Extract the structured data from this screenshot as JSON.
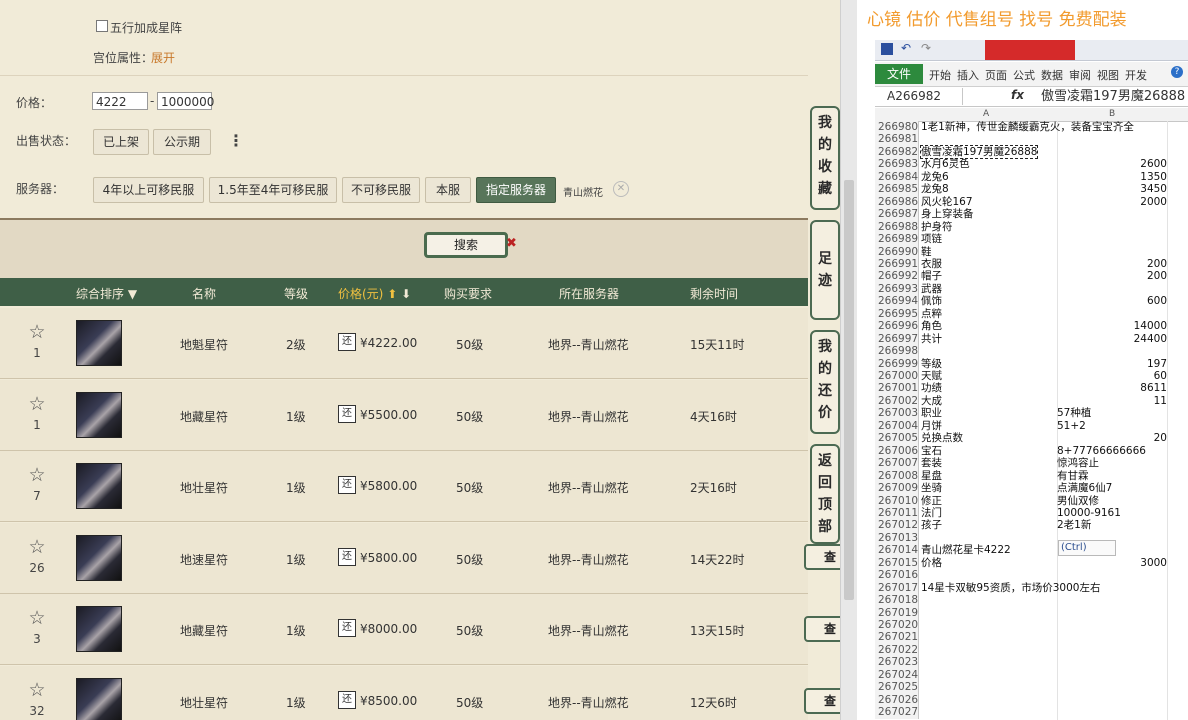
{
  "filters": {
    "wuxing_label": "五行加成星阵",
    "gongwei_label": "宫位属性：",
    "gongwei_link": "展开",
    "price_label": "价格：",
    "price_min": "4222",
    "price_sep": "-",
    "price_max": "1000000",
    "sale_status_label": "出售状态：",
    "sale_status_options": [
      "已上架",
      "公示期"
    ],
    "more_icon": "⋮",
    "server_label": "服务器：",
    "server_options": [
      "4年以上可移民服",
      "1.5年至4年可移民服",
      "不可移民服",
      "本服",
      "指定服务器"
    ],
    "selected_server": "青山燃花"
  },
  "search": {
    "label": "搜索"
  },
  "table": {
    "headers": {
      "sort": "综合排序",
      "name": "名称",
      "level": "等级",
      "price": "价格(元)",
      "requirement": "购买要求",
      "server": "所在服务器",
      "time_left": "剩余时间"
    },
    "rows": [
      {
        "count": "1",
        "name": "地魁星符",
        "level": "2级",
        "price": "¥4222.00",
        "req": "50级",
        "server": "地界--青山燃花",
        "time": "15天11时"
      },
      {
        "count": "1",
        "name": "地藏星符",
        "level": "1级",
        "price": "¥5500.00",
        "req": "50级",
        "server": "地界--青山燃花",
        "time": "4天16时"
      },
      {
        "count": "7",
        "name": "地壮星符",
        "level": "1级",
        "price": "¥5800.00",
        "req": "50级",
        "server": "地界--青山燃花",
        "time": "2天16时"
      },
      {
        "count": "26",
        "name": "地速星符",
        "level": "1级",
        "price": "¥5800.00",
        "req": "50级",
        "server": "地界--青山燃花",
        "time": "14天22时"
      },
      {
        "count": "3",
        "name": "地藏星符",
        "level": "1级",
        "price": "¥8000.00",
        "req": "50级",
        "server": "地界--青山燃花",
        "time": "13天15时"
      },
      {
        "count": "32",
        "name": "地壮星符",
        "level": "1级",
        "price": "¥8500.00",
        "req": "50级",
        "server": "地界--青山燃花",
        "time": "12天6时"
      }
    ],
    "huan_label": "还",
    "view_label": "查看"
  },
  "side_tabs": [
    {
      "label": "我的收藏"
    },
    {
      "label": "足迹"
    },
    {
      "label": "我的还价"
    },
    {
      "label": "返回顶部"
    }
  ],
  "excel": {
    "banner": "心镜 估价 代售组号 找号 免费配装",
    "file_tab": "文件",
    "ribbon_tabs": [
      "开始",
      "插入",
      "页面",
      "公式",
      "数据",
      "审阅",
      "视图",
      "开发"
    ],
    "name_box": "A266982",
    "fx": "fx",
    "formula": "傲雪凌霜197男魔26888",
    "col_a": "A",
    "col_b": "B",
    "ctrl_tag": "(Ctrl)",
    "rows": [
      {
        "rn": "266980",
        "a": "1老1新神，传世金麟缓霸克火，装备宝宝齐全",
        "b": ""
      },
      {
        "rn": "266981",
        "a": "",
        "b": ""
      },
      {
        "rn": "266982",
        "a": "傲雪凌霜197男魔26888",
        "b": ""
      },
      {
        "rn": "266983",
        "a": "水月6灵色",
        "b": "2600"
      },
      {
        "rn": "266984",
        "a": "龙兔6",
        "b": "1350"
      },
      {
        "rn": "266985",
        "a": "龙兔8",
        "b": "3450"
      },
      {
        "rn": "266986",
        "a": "风火轮167",
        "b": "2000"
      },
      {
        "rn": "266987",
        "a": "身上穿装备",
        "b": ""
      },
      {
        "rn": "266988",
        "a": "护身符",
        "b": ""
      },
      {
        "rn": "266989",
        "a": "项链",
        "b": ""
      },
      {
        "rn": "266990",
        "a": "鞋",
        "b": ""
      },
      {
        "rn": "266991",
        "a": "衣服",
        "b": "200"
      },
      {
        "rn": "266992",
        "a": "帽子",
        "b": "200"
      },
      {
        "rn": "266993",
        "a": "武器",
        "b": ""
      },
      {
        "rn": "266994",
        "a": "佩饰",
        "b": "600"
      },
      {
        "rn": "266995",
        "a": "点粹",
        "b": ""
      },
      {
        "rn": "266996",
        "a": "角色",
        "b": "14000"
      },
      {
        "rn": "266997",
        "a": "共计",
        "b": "24400"
      },
      {
        "rn": "266998",
        "a": "",
        "b": ""
      },
      {
        "rn": "266999",
        "a": "等级",
        "b": "197"
      },
      {
        "rn": "267000",
        "a": "天赋",
        "b": "60"
      },
      {
        "rn": "267001",
        "a": "功绩",
        "b": "8611"
      },
      {
        "rn": "267002",
        "a": "大成",
        "b": "11"
      },
      {
        "rn": "267003",
        "a": "职业",
        "b": "57种植",
        "left": true
      },
      {
        "rn": "267004",
        "a": "月饼",
        "b": "51+2",
        "left": true
      },
      {
        "rn": "267005",
        "a": "兑换点数",
        "b": "20"
      },
      {
        "rn": "267006",
        "a": "宝石",
        "b": "8+77766666666",
        "left": true
      },
      {
        "rn": "267007",
        "a": "套装",
        "b": "惊鸿容止",
        "left": true
      },
      {
        "rn": "267008",
        "a": "星盘",
        "b": "有甘霖",
        "left": true
      },
      {
        "rn": "267009",
        "a": "坐骑",
        "b": "点满魔6仙7",
        "left": true
      },
      {
        "rn": "267010",
        "a": "修正",
        "b": "男仙双修",
        "left": true
      },
      {
        "rn": "267011",
        "a": "法门",
        "b": "10000-9161",
        "left": true
      },
      {
        "rn": "267012",
        "a": "孩子",
        "b": "2老1新",
        "left": true
      },
      {
        "rn": "267013",
        "a": "",
        "b": ""
      },
      {
        "rn": "267014",
        "a": "青山燃花星卡4222",
        "b": ""
      },
      {
        "rn": "267015",
        "a": "价格",
        "b": "3000"
      },
      {
        "rn": "267016",
        "a": "",
        "b": ""
      },
      {
        "rn": "267017",
        "a": "14星卡双敏95资质，市场价3000左右",
        "b": ""
      },
      {
        "rn": "267018",
        "a": "",
        "b": ""
      },
      {
        "rn": "267019",
        "a": "",
        "b": ""
      },
      {
        "rn": "267020",
        "a": "",
        "b": ""
      },
      {
        "rn": "267021",
        "a": "",
        "b": ""
      },
      {
        "rn": "267022",
        "a": "",
        "b": ""
      },
      {
        "rn": "267023",
        "a": "",
        "b": ""
      },
      {
        "rn": "267024",
        "a": "",
        "b": ""
      },
      {
        "rn": "267025",
        "a": "",
        "b": ""
      },
      {
        "rn": "267026",
        "a": "",
        "b": ""
      },
      {
        "rn": "267027",
        "a": "",
        "b": ""
      }
    ]
  }
}
